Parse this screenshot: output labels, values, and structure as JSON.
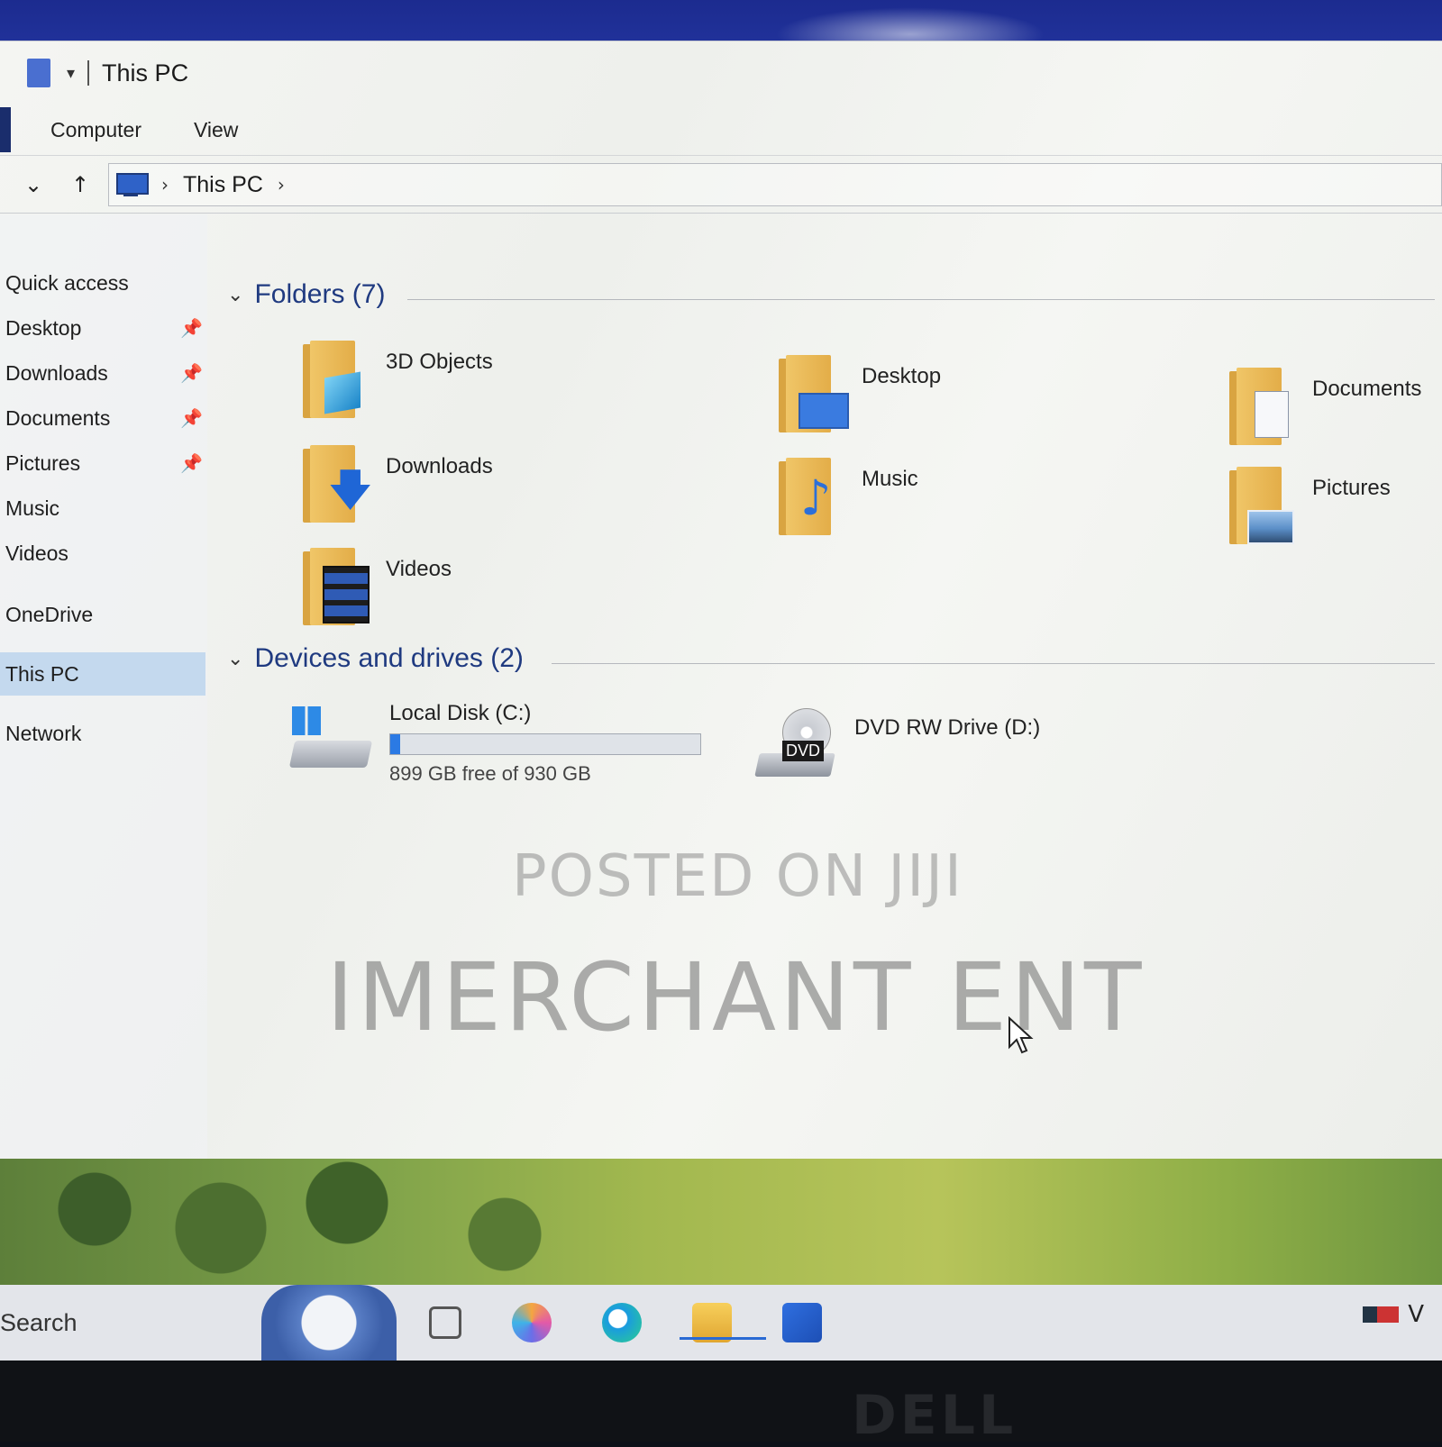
{
  "window": {
    "title": "This PC",
    "ribbon_tabs": [
      "Computer",
      "View"
    ]
  },
  "address": {
    "crumb": "This PC"
  },
  "sidebar": {
    "items": [
      {
        "label": "Quick access",
        "pinned": false
      },
      {
        "label": "Desktop",
        "pinned": true
      },
      {
        "label": "Downloads",
        "pinned": true
      },
      {
        "label": "Documents",
        "pinned": true
      },
      {
        "label": "Pictures",
        "pinned": true
      },
      {
        "label": "Music",
        "pinned": false
      },
      {
        "label": "Videos",
        "pinned": false
      },
      {
        "label": "OneDrive",
        "pinned": false
      },
      {
        "label": "This PC",
        "pinned": false,
        "selected": true
      },
      {
        "label": "Network",
        "pinned": false
      }
    ]
  },
  "folders_group": {
    "header": "Folders (7)",
    "items": [
      "3D Objects",
      "Desktop",
      "Documents",
      "Downloads",
      "Music",
      "Pictures",
      "Videos"
    ]
  },
  "drives_group": {
    "header": "Devices and drives (2)",
    "drives": [
      {
        "name": "Local Disk (C:)",
        "free_text": "899 GB free of 930 GB",
        "used_fraction": 0.033
      },
      {
        "name": "DVD RW Drive (D:)",
        "badge": "DVD"
      }
    ]
  },
  "watermarks": {
    "line1": "POSTED ON JIJI",
    "line2": "IMERCHANT ENT"
  },
  "taskbar": {
    "search": "Search",
    "tray_text": "V"
  },
  "monitor": {
    "brand": "DELL"
  },
  "colors": {
    "accent": "#2b7ae4",
    "selected_nav": "#c4d9ee",
    "group_header": "#1f3a80",
    "folder": "#e3ad48"
  }
}
